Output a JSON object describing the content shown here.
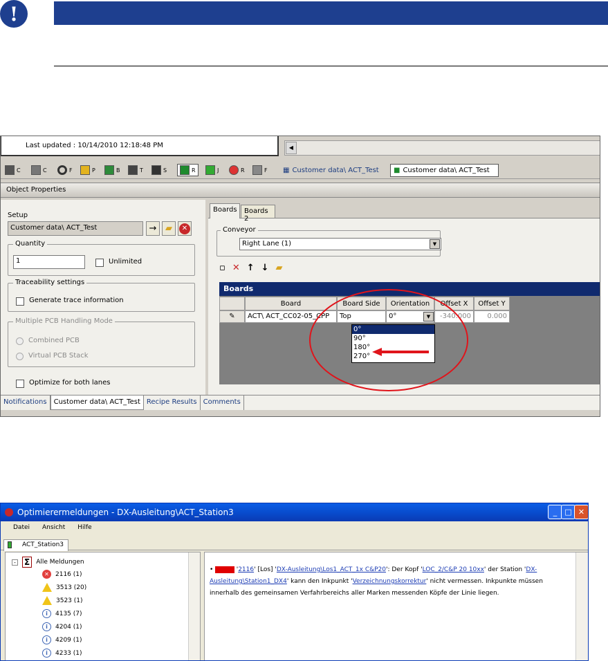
{
  "notice": {
    "icon_glyph": "!",
    "bar_color": "#1e3f8f"
  },
  "shot1": {
    "last_updated": "Last updated : 10/14/2010 12:18:48 PM",
    "toolbar_items": [
      "C",
      "C",
      "F",
      "P",
      "B",
      "T",
      "S",
      "R",
      "J",
      "R",
      "F"
    ],
    "recipe_tabs": [
      "Customer data\\ ACT_Test",
      "Customer data\\ ACT_Test"
    ],
    "object_properties": "Object Properties",
    "setup": {
      "label": "Setup",
      "value": "Customer data\\ ACT_Test",
      "quantity_label": "Quantity",
      "quantity_value": "1",
      "unlimited_label": "Unlimited",
      "traceability_label": "Traceability settings",
      "generate_label": "Generate trace information",
      "multiple_label": "Multiple PCB Handling Mode",
      "combined_label": "Combined PCB",
      "virtual_label": "Virtual PCB Stack",
      "optimize_label": "Optimize for both lanes"
    },
    "tabs": [
      "Boards",
      "Boards 2"
    ],
    "conveyor_label": "Conveyor",
    "conveyor_value": "Right Lane (1)",
    "boards_title": "Boards",
    "columns": [
      "Board",
      "Board Side",
      "Orientation",
      "Offset X",
      "Offset Y"
    ],
    "row": {
      "board": "ACT\\ ACT_CC02-05_CPP",
      "side": "Top",
      "orientation": "0°",
      "offset_x": "-340.000",
      "offset_y": "0.000"
    },
    "orientation_options": [
      "0°",
      "90°",
      "180°",
      "270°"
    ],
    "bottom_tabs": [
      "Notifications",
      "Customer data\\ ACT_Test",
      "Recipe Results",
      "Comments"
    ],
    "highlight_color": "#e0141b"
  },
  "shot2": {
    "title": "Optimierermeldungen - DX-Ausleitung\\ACT_Station3",
    "menu": [
      "Datei",
      "Ansicht",
      "Hilfe"
    ],
    "tab": "ACT_Station3",
    "tree_root": "Alle Meldungen",
    "tree_items": [
      {
        "type": "error",
        "label": "2116 (1)"
      },
      {
        "type": "warning",
        "label": "3513 (20)"
      },
      {
        "type": "warning",
        "label": "3523 (1)"
      },
      {
        "type": "info",
        "label": "4135 (7)"
      },
      {
        "type": "info",
        "label": "4204 (1)"
      },
      {
        "type": "info",
        "label": "4209 (1)"
      },
      {
        "type": "info",
        "label": "4233 (1)"
      }
    ],
    "message": {
      "bullet": "•",
      "tag": "Fehler",
      "code": "2116",
      "los": "[Los]",
      "link1": "DX-Ausleitung\\Los1_ACT_1x C&P20",
      "t1": ": Der Kopf '",
      "head": "LOC_2/C&P 20 10xx",
      "t2": "' der Station '",
      "station": "DX-Ausleitung\\Station1_DX4",
      "t3": "' kann den Inkpunkt '",
      "ink": "Verzeichnungskorrektur",
      "t4": "' nicht vermessen. Inkpunkte müssen innerhalb des gemeinsamen Verfahrbereichs aller Marken messenden Köpfe der Linie liegen."
    }
  }
}
